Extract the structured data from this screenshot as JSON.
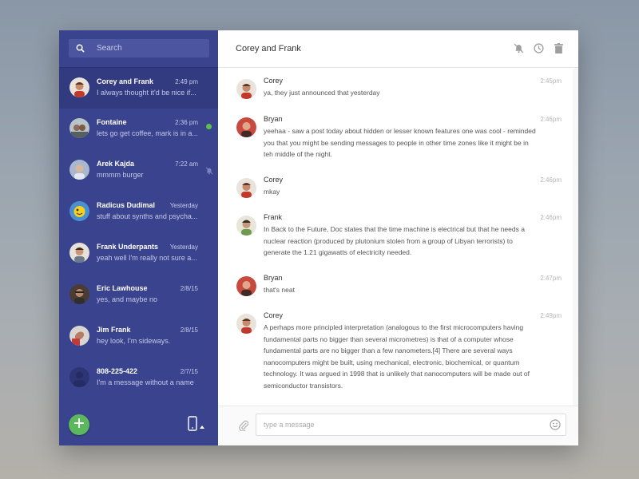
{
  "search": {
    "placeholder": "Search"
  },
  "conversations": [
    {
      "name": "Corey and Frank",
      "time": "2:49 pm",
      "preview": "I always thought it'd be nice if..."
    },
    {
      "name": "Fontaine",
      "time": "2:36 pm",
      "preview": "lets go get coffee, mark is in a..."
    },
    {
      "name": "Arek Kajda",
      "time": "7:22 am",
      "preview": "mmmm burger"
    },
    {
      "name": "Radicus Dudimal",
      "time": "Yesterday",
      "preview": "stuff about synths and psycha..."
    },
    {
      "name": "Frank Underpants",
      "time": "Yesterday",
      "preview": "yeah well I'm really not sure a..."
    },
    {
      "name": "Eric Lawhouse",
      "time": "2/8/15",
      "preview": "yes, and maybe no"
    },
    {
      "name": "Jim Frank",
      "time": "2/8/15",
      "preview": "hey look, I'm sideways."
    },
    {
      "name": "808-225-422",
      "time": "2/7/15",
      "preview": "I'm a message without a name"
    }
  ],
  "header": {
    "title": "Corey and Frank"
  },
  "messages": [
    {
      "sender": "Corey",
      "time": "2:45pm",
      "text": "ya, they just announced that yesterday"
    },
    {
      "sender": "Bryan",
      "time": "2:46pm",
      "text": "yeehaa - saw a post today about hidden or lesser known features one was cool - reminded you that you might be sending messages to people in other time zones like it might be in teh middle of the night."
    },
    {
      "sender": "Corey",
      "time": "2:46pm",
      "text": "mkay"
    },
    {
      "sender": "Frank",
      "time": "2:46pm",
      "text": "In Back to the Future, Doc states that the time machine is electrical but that he needs a nuclear reaction (produced by plutonium stolen from a group of Libyan terrorists) to generate the 1.21 gigawatts of electricity needed."
    },
    {
      "sender": "Bryan",
      "time": "2:47pm",
      "text": "that's neat"
    },
    {
      "sender": "Corey",
      "time": "2:49pm",
      "text": "A perhaps more principled interpretation (analogous to the first microcomputers having fundamental parts no bigger than several micrometres) is that of a computer whose fundamental parts are no bigger than a few nanometers.[4] There are several ways nanocomputers might be built, using mechanical, electronic, biochemical, or quantum technology. It was argued in 1998 that is unlikely that nanocomputers will be made out of semiconductor transistors."
    }
  ],
  "composer": {
    "placeholder": "type a message"
  },
  "icons": {
    "search": "search-icon",
    "mute": "bell-off-icon",
    "clock": "clock-icon",
    "trash": "trash-icon",
    "add": "plus-icon",
    "device": "phone-icon",
    "attach": "paperclip-icon",
    "emoji": "smiley-icon"
  },
  "colors": {
    "sidebar": "#3a438d",
    "sidebar_active": "#323a80",
    "accent_green": "#5cb85c",
    "online": "#5fbf4e"
  }
}
